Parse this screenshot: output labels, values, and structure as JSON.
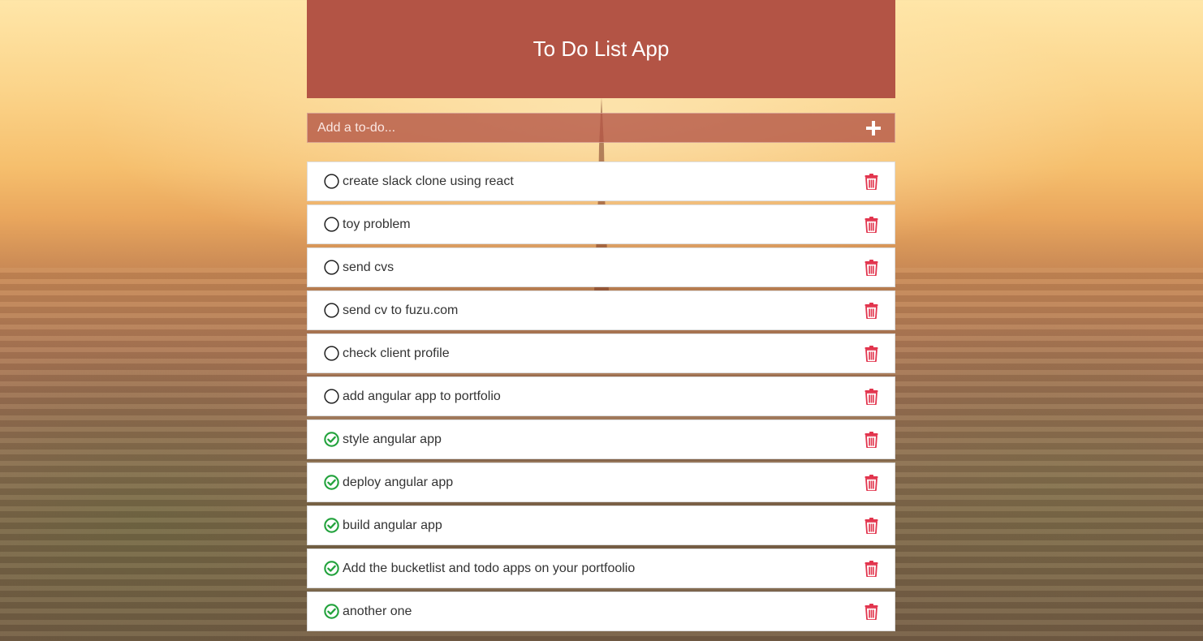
{
  "app": {
    "title": "To Do List App"
  },
  "add_form": {
    "placeholder": "Add a to-do...",
    "add_icon": "plus-icon"
  },
  "colors": {
    "header_bg": "#b35445",
    "add_bar_bg": "#c07060",
    "done_check": "#22a23c",
    "trash": "#e2344d",
    "text": "#333333"
  },
  "todos": [
    {
      "text": "create slack clone using react",
      "done": false
    },
    {
      "text": "toy problem",
      "done": false
    },
    {
      "text": "send cvs",
      "done": false
    },
    {
      "text": "send cv to fuzu.com",
      "done": false
    },
    {
      "text": "check client profile",
      "done": false
    },
    {
      "text": "add angular app to portfolio",
      "done": false
    },
    {
      "text": "style angular app",
      "done": true
    },
    {
      "text": "deploy angular app",
      "done": true
    },
    {
      "text": "build angular app",
      "done": true
    },
    {
      "text": "Add the bucketlist and todo apps on your portfoolio",
      "done": true
    },
    {
      "text": "another one",
      "done": true
    }
  ]
}
